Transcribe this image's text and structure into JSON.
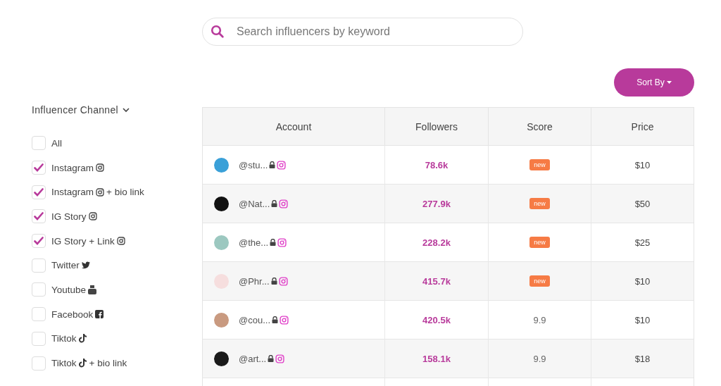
{
  "search": {
    "placeholder": "Search influencers by keyword"
  },
  "sort_button": {
    "label": "Sort By"
  },
  "filter": {
    "title": "Influencer Channel",
    "expanded": true,
    "channels": [
      {
        "label": "All",
        "kind": "plain",
        "checked": false
      },
      {
        "label": "Instagram",
        "kind": "instagram",
        "checked": true
      },
      {
        "label": "Instagram",
        "kind": "instagram",
        "suffix": "+ bio link",
        "checked": true
      },
      {
        "label": "IG Story",
        "kind": "instagram",
        "checked": true
      },
      {
        "label": "IG Story + Link",
        "kind": "instagram",
        "checked": true
      },
      {
        "label": "Twitter",
        "kind": "twitter",
        "checked": false
      },
      {
        "label": "Youtube",
        "kind": "youtube",
        "checked": false
      },
      {
        "label": "Facebook",
        "kind": "facebook",
        "checked": false
      },
      {
        "label": "Tiktok",
        "kind": "tiktok",
        "checked": false
      },
      {
        "label": "Tiktok",
        "kind": "tiktok",
        "suffix": "+ bio link",
        "checked": false
      }
    ]
  },
  "table": {
    "columns": [
      "Account",
      "Followers",
      "Score",
      "Price"
    ],
    "rows": [
      {
        "account": "@stu...",
        "locked": true,
        "followers": "78.6k",
        "score": {
          "kind": "badge",
          "text": "new"
        },
        "price": "$10"
      },
      {
        "account": "@Nat...",
        "locked": true,
        "followers": "277.9k",
        "score": {
          "kind": "badge",
          "text": "new"
        },
        "price": "$50"
      },
      {
        "account": "@the...",
        "locked": true,
        "followers": "228.2k",
        "score": {
          "kind": "badge",
          "text": "new"
        },
        "price": "$25"
      },
      {
        "account": "@Phr...",
        "locked": true,
        "followers": "415.7k",
        "score": {
          "kind": "badge",
          "text": "new"
        },
        "price": "$10"
      },
      {
        "account": "@cou...",
        "locked": true,
        "followers": "420.5k",
        "score": {
          "kind": "number",
          "text": "9.9"
        },
        "price": "$10"
      },
      {
        "account": "@art...",
        "locked": true,
        "followers": "158.1k",
        "score": {
          "kind": "number",
          "text": "9.9"
        },
        "price": "$18"
      }
    ]
  }
}
